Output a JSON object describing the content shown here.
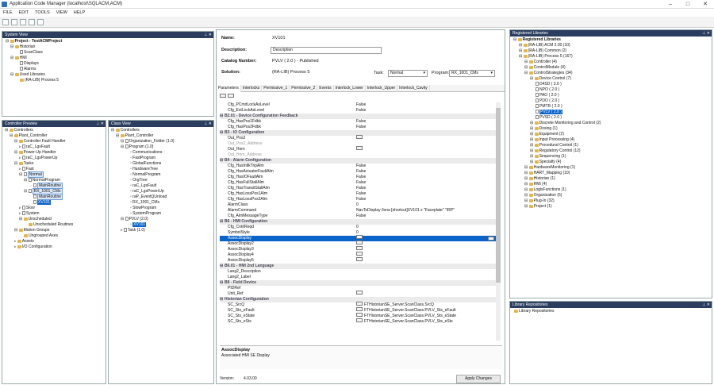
{
  "app": {
    "title": "Application Code Manager (localhost\\SQLACM,ACM)"
  },
  "menu": [
    "FILE",
    "EDIT",
    "TOOLS",
    "VIEW",
    "HELP"
  ],
  "system_view": {
    "title": "System View",
    "items": [
      "Project - TestACMProject",
      "Historian",
      "ScanClass",
      "HMI",
      "Displays",
      "Alarms",
      "Used Libraries",
      "(RA-LIB) Process 5"
    ]
  },
  "controller_preview": {
    "title": "Controller Preview",
    "items": [
      "Controllers",
      "Plant_Controller",
      "Controller Fault Handler",
      "raC_LgxFault",
      "Power-Up Handler",
      "raC_LgxPowerUp",
      "Tasks",
      "Fast",
      "Normal",
      "NormalProgram",
      "MainRoutine",
      "RX_1001_CMs",
      "MainRoutine",
      "XV101",
      "Slow",
      "System",
      "Unscheduled",
      "Unscheduled Routines",
      "Motion Groups",
      "Ungrouped Axes",
      "Assets",
      "I/O Configuration"
    ]
  },
  "class_view": {
    "title": "Class View",
    "items": [
      "Controllers",
      "Plant_Controller",
      "Organization_Folder (1.0)",
      "Program (1.0)",
      "Communications",
      "FastProgram",
      "GlobalFunctions",
      "HardwareTree",
      "NormalProgram",
      "OrgTree",
      "raC_LgxFault",
      "raC_LgxPowerUp",
      "raP_EventQUnload",
      "RX_1001_CMs",
      "SlowProgram",
      "SystemProgram",
      "PVLV (2.0)",
      "XV101",
      "Task (1.0)"
    ]
  },
  "props": {
    "name_label": "Name:",
    "name_value": "XV101",
    "desc_label": "Description:",
    "desc_value": "Description",
    "cat_label": "Catalog Number:",
    "cat_value": "PVLV",
    "cat_ver": "( 2.0 )",
    "cat_status": "- Published",
    "sol_label": "Solution:",
    "sol_value": "(RA-LIB) Process 5",
    "task_label": "Task:",
    "task_value": "Normal",
    "prog_label": "Program:",
    "prog_value": "RX_1001_CMs"
  },
  "tabs": [
    "Parameters",
    "Interlocks",
    "Permissive_1",
    "Permissive_2",
    "Events",
    "Interlock_Lower",
    "Interlock_Upper",
    "Interlock_Cavity"
  ],
  "grid_rows": [
    {
      "n": "Cfg_PCmdLockAsLevel",
      "v": "False",
      "t": "p"
    },
    {
      "n": "Cfg_ExtLockAsLevel",
      "v": "False",
      "t": "p"
    },
    {
      "n": "B2.01 - Device Configuration Feedback",
      "v": "",
      "t": "cat"
    },
    {
      "n": "Cfg_HasPos1Fdbk",
      "v": "False",
      "t": "p"
    },
    {
      "n": "Cfg_HasPos2Fdbk",
      "v": "False",
      "t": "p"
    },
    {
      "n": "B3 - IO Configuration",
      "v": "",
      "t": "cat"
    },
    {
      "n": "Out_Pos2",
      "v": "",
      "t": "b"
    },
    {
      "n": "Out_Pos2_Address",
      "v": "",
      "t": "d"
    },
    {
      "n": "Out_Horn",
      "v": "",
      "t": "b"
    },
    {
      "n": "Out_Horn_Address",
      "v": "",
      "t": "d"
    },
    {
      "n": "B4 - Alarm Configuration",
      "v": "",
      "t": "cat"
    },
    {
      "n": "Cfg_HasIntlkTripAlm",
      "v": "False",
      "t": "p"
    },
    {
      "n": "Cfg_HasActuatorFaultAlm",
      "v": "False",
      "t": "p"
    },
    {
      "n": "Cfg_HasIOFaultAlm",
      "v": "False",
      "t": "p"
    },
    {
      "n": "Cfg_HasFullStallAlm",
      "v": "False",
      "t": "p"
    },
    {
      "n": "Cfg_HasTransitStallAlm",
      "v": "False",
      "t": "p"
    },
    {
      "n": "Cfg_HasLossPos1Alm",
      "v": "False",
      "t": "p"
    },
    {
      "n": "Cfg_HasLossPos2Alm",
      "v": "False",
      "t": "p"
    },
    {
      "n": "AlarmClass",
      "v": "0",
      "t": "p"
    },
    {
      "n": "AlarmCommand",
      "v": "NavToDisplay /lona [shortcut]XV101 x \"Faceplate\" \"/RP\"",
      "t": "p"
    },
    {
      "n": "Cfg_AlmMessageType",
      "v": "False",
      "t": "p"
    },
    {
      "n": "B6 - HMI Configuration",
      "v": "",
      "t": "cat"
    },
    {
      "n": "Cfg_CntrlReqd",
      "v": "0",
      "t": "p"
    },
    {
      "n": "SymbolStyle",
      "v": "0",
      "t": "p"
    },
    {
      "n": "AssocDisplay",
      "v": "",
      "t": "hl"
    },
    {
      "n": "AssocDisplay2",
      "v": "",
      "t": "b"
    },
    {
      "n": "AssocDisplay3",
      "v": "",
      "t": "b"
    },
    {
      "n": "AssocDisplay4",
      "v": "",
      "t": "b"
    },
    {
      "n": "AssocDisplay5",
      "v": "",
      "t": "b"
    },
    {
      "n": "B6.01 - HMI 2nd Language",
      "v": "",
      "t": "cat"
    },
    {
      "n": "Lang2_Description",
      "v": "",
      "t": "p"
    },
    {
      "n": "Lang2_Label",
      "v": "",
      "t": "p"
    },
    {
      "n": "B8 - Field Device",
      "v": "",
      "t": "cat"
    },
    {
      "n": "PIDRef",
      "v": "",
      "t": "p"
    },
    {
      "n": "Unit_Ref",
      "v": "",
      "t": "b"
    },
    {
      "n": "Historian Configuration",
      "v": "",
      "t": "cat"
    },
    {
      "n": "SC_SrcQ",
      "v": "FTHistorianSE_Server.ScanClass.SrcQ",
      "t": "b"
    },
    {
      "n": "SC_Sts_eFault",
      "v": "FTHistorianSE_Server.ScanClass.PVLV_Sts_eFault",
      "t": "b"
    },
    {
      "n": "SC_Sts_eState",
      "v": "FTHistorianSE_Server.ScanClass.PVLV_Sts_eState",
      "t": "b"
    },
    {
      "n": "SC_Sts_eSts",
      "v": "FTHistorianSE_Server.ScanClass.PVLV_Sts_eSts",
      "t": "b"
    }
  ],
  "description_box": {
    "title": "AssocDisplay",
    "text": "Associated HMI SE Display"
  },
  "footer": {
    "version_label": "Version:",
    "version": "4.03.00",
    "apply": "Apply Changes"
  },
  "registered_libraries": {
    "title": "Registered Libraries",
    "items": [
      {
        "t": "Registered Libraries",
        "l": 0,
        "b": true
      },
      {
        "t": "(RA-LIB) ACM 2.00 (10)",
        "l": 1
      },
      {
        "t": "(RA-LIB) Common (2)",
        "l": 1
      },
      {
        "t": "(RA-LIB) Process 5 (167)",
        "l": 1
      },
      {
        "t": "Controller (4)",
        "l": 2
      },
      {
        "t": "ControlModule (4)",
        "l": 2
      },
      {
        "t": "ControlStrategies (34)",
        "l": 2
      },
      {
        "t": "Device Control (7)",
        "l": 3
      },
      {
        "t": "D4SD ( 2.0 )",
        "l": 4
      },
      {
        "t": "NPO ( 2.0 )",
        "l": 4
      },
      {
        "t": "PAO ( 2.0 )",
        "l": 4
      },
      {
        "t": "PDO ( 2.0 )",
        "l": 4
      },
      {
        "t": "PMTR ( 2.0 )",
        "l": 4
      },
      {
        "t": "PVLV ( 2.0 )",
        "l": 4,
        "sel": true
      },
      {
        "t": "PVSD ( 2.0 )",
        "l": 4
      },
      {
        "t": "Discrete Monitoring and Control (2)",
        "l": 3
      },
      {
        "t": "Dosing (1)",
        "l": 3
      },
      {
        "t": "Equipment (2)",
        "l": 3
      },
      {
        "t": "Input Processing (4)",
        "l": 3
      },
      {
        "t": "Procedural Control (1)",
        "l": 3
      },
      {
        "t": "Regulatory Control (12)",
        "l": 3
      },
      {
        "t": "Sequencing (1)",
        "l": 3
      },
      {
        "t": "Specialty (4)",
        "l": 3
      },
      {
        "t": "HardwareMonitoring (1)",
        "l": 2
      },
      {
        "t": "HART_Mapping (10)",
        "l": 2
      },
      {
        "t": "Historian (1)",
        "l": 2
      },
      {
        "t": "HMI (4)",
        "l": 2
      },
      {
        "t": "LogixFunctions (1)",
        "l": 2
      },
      {
        "t": "Organization (5)",
        "l": 2
      },
      {
        "t": "Plug-In (32)",
        "l": 2
      },
      {
        "t": "Project (1)",
        "l": 2
      }
    ]
  },
  "library_repositories": {
    "title": "Library Repositories",
    "items": [
      "Library Repositories"
    ]
  }
}
